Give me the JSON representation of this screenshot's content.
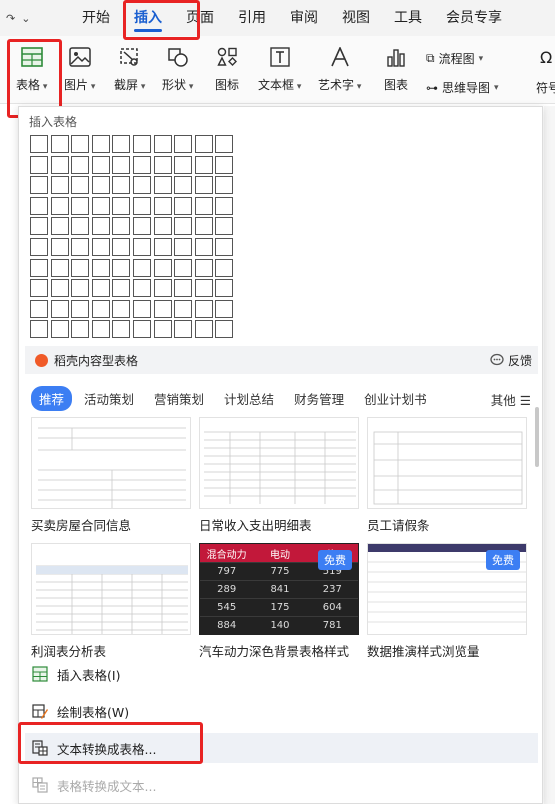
{
  "menubar": {
    "tabs": [
      "开始",
      "插入",
      "页面",
      "引用",
      "审阅",
      "视图",
      "工具",
      "会员专享"
    ],
    "active": "插入"
  },
  "ribbon": {
    "buttons": [
      {
        "label": "表格",
        "icon": "table-icon"
      },
      {
        "label": "图片",
        "icon": "picture-icon"
      },
      {
        "label": "截屏",
        "icon": "scissors-icon"
      },
      {
        "label": "形状",
        "icon": "shapes-icon"
      },
      {
        "label": "图标",
        "icon": "icons-icon"
      },
      {
        "label": "文本框",
        "icon": "textbox-icon"
      },
      {
        "label": "艺术字",
        "icon": "wordart-icon"
      },
      {
        "label": "图表",
        "icon": "chart-icon"
      }
    ],
    "flowchart": "流程图",
    "mindmap": "思维导图",
    "symbol": "符号"
  },
  "panel": {
    "insert_table_title": "插入表格",
    "grid": {
      "columns": 10,
      "rows": 10
    },
    "daoke_label": "稻壳内容型表格",
    "feedback": "反馈",
    "categories": [
      "推荐",
      "活动策划",
      "营销策划",
      "计划总结",
      "财务管理",
      "创业计划书"
    ],
    "more": "其他",
    "templates": [
      {
        "name": "买卖房屋合同信息",
        "free": false,
        "dark": false
      },
      {
        "name": "日常收入支出明细表",
        "free": false,
        "dark": false
      },
      {
        "name": "员工请假条",
        "free": false,
        "dark": false
      },
      {
        "name": "利润表分析表",
        "free": false,
        "dark": false
      },
      {
        "name": "汽车动力深色背景表格样式",
        "free": true,
        "dark": true
      },
      {
        "name": "数据推演样式浏览量",
        "free": true,
        "dark": false
      }
    ],
    "free_badge": "免费",
    "dark_table": {
      "headers": [
        "混合动力",
        "电动",
        "汽"
      ],
      "rows": [
        [
          "797",
          "775",
          "519"
        ],
        [
          "289",
          "841",
          "237"
        ],
        [
          "545",
          "175",
          "604"
        ],
        [
          "884",
          "140",
          "781"
        ]
      ]
    },
    "commands": [
      {
        "label": "插入表格(I)",
        "icon": "insert-table-icon",
        "state": "normal"
      },
      {
        "label": "绘制表格(W)",
        "icon": "draw-table-icon",
        "state": "normal"
      },
      {
        "label": "文本转换成表格...",
        "icon": "text-to-table-icon",
        "state": "hover"
      },
      {
        "label": "表格转换成文本...",
        "icon": "table-to-text-icon",
        "state": "disabled"
      }
    ]
  },
  "colors": {
    "accent": "#3c7ef3",
    "highlight": "#e82323",
    "flame": "#f05a28"
  }
}
